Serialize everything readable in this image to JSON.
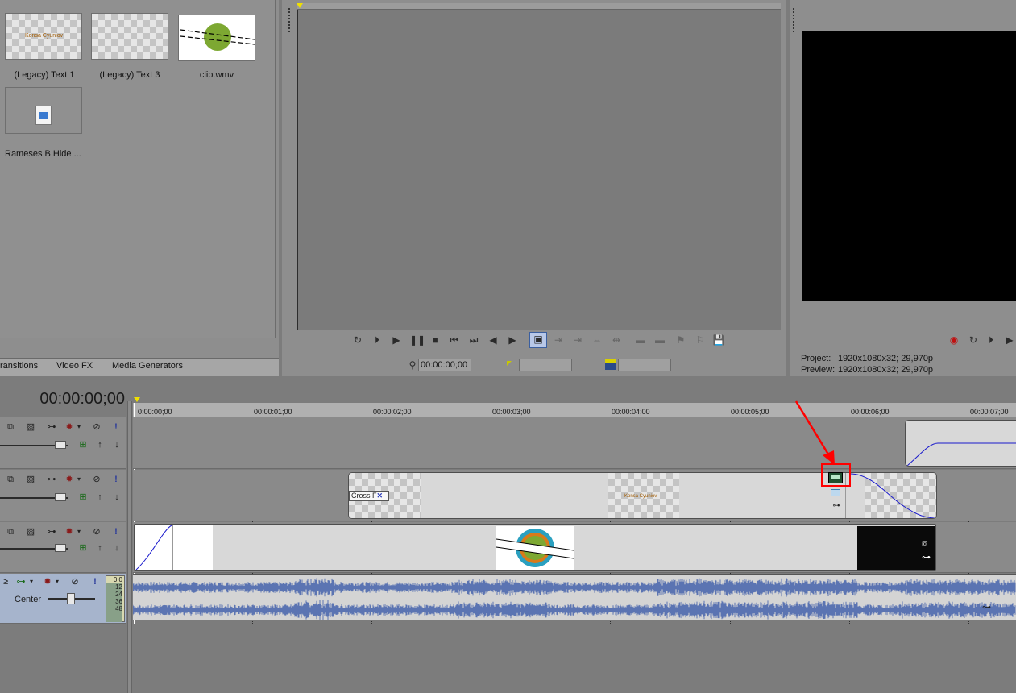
{
  "media": {
    "items": [
      {
        "label": "(Legacy) Text 1",
        "thumb_text": "Konsa Cyuniov"
      },
      {
        "label": "(Legacy) Text 3",
        "thumb_text": ""
      },
      {
        "label": "clip.wmv",
        "thumb_text": ""
      },
      {
        "label": "Rameses B Hide ...",
        "thumb_text": ""
      }
    ],
    "tabs": [
      "ransitions",
      "Video FX",
      "Media Generators"
    ]
  },
  "trimmer": {
    "timecode": "00:00:00;00"
  },
  "preview": {
    "project_label": "Project:",
    "project_value": "1920x1080x32; 29,970p",
    "preview_label": "Preview:",
    "preview_value": "1920x1080x32; 29,970p"
  },
  "timeline": {
    "timecode": "00:00:00;00",
    "ruler": [
      "0:00:00;00",
      "00:00:01;00",
      "00:00:02;00",
      "00:00:03;00",
      "00:00:04;00",
      "00:00:05;00",
      "00:00:06;00",
      "00:00:07;00"
    ],
    "clips": {
      "crossfade_label": "Cross F",
      "text_clip_caption": "Konsa Cyuniov"
    },
    "audio": {
      "pan_label": "Center",
      "meter_values": [
        "0,0",
        "12",
        "24",
        "36",
        "48"
      ]
    }
  },
  "colors": {
    "highlight": "#ff0000",
    "waveform": "#5b74b2",
    "envelope": "#1a1acc"
  }
}
